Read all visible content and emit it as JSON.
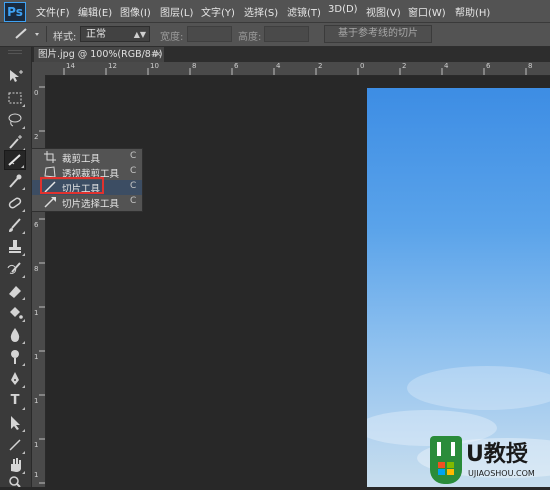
{
  "menubar": {
    "logo": "Ps",
    "items": [
      "文件(F)",
      "编辑(E)",
      "图像(I)",
      "图层(L)",
      "文字(Y)",
      "选择(S)",
      "滤镜(T)",
      "3D(D)",
      "视图(V)",
      "窗口(W)",
      "帮助(H)"
    ]
  },
  "options": {
    "style_label": "样式:",
    "style_value": "正常",
    "width_label": "宽度:",
    "height_label": "高度:",
    "slices_from_guides": "基于参考线的切片"
  },
  "document": {
    "tab_title": "图片.jpg @ 100%(RGB/8#)",
    "close": "×"
  },
  "rulers": {
    "top": [
      "14",
      "12",
      "10",
      "8",
      "6",
      "4",
      "2",
      "0",
      "2",
      "4",
      "6",
      "8"
    ],
    "left": [
      "0",
      "2",
      "4",
      "6",
      "8",
      "1",
      "1",
      "1",
      "1",
      "1"
    ]
  },
  "flyout": {
    "items": [
      {
        "icon": "crop-icon",
        "label": "裁剪工具",
        "key": "C"
      },
      {
        "icon": "perspective-crop-icon",
        "label": "透视裁剪工具",
        "key": "C"
      },
      {
        "icon": "slice-icon",
        "label": "切片工具",
        "key": "C",
        "selected": true
      },
      {
        "icon": "slice-select-icon",
        "label": "切片选择工具",
        "key": "C"
      }
    ]
  },
  "tools": [
    "move-tool",
    "marquee-tool",
    "lasso-tool",
    "magic-wand-tool",
    "crop-tool",
    "eyedropper-tool",
    "healing-brush-tool",
    "brush-tool",
    "clone-stamp-tool",
    "history-brush-tool",
    "eraser-tool",
    "gradient-tool",
    "blur-tool",
    "dodge-tool",
    "pen-tool",
    "type-tool",
    "path-selection-tool",
    "line-tool",
    "hand-tool",
    "zoom-tool"
  ],
  "watermark": {
    "title": "U教授",
    "url": "UJIAOSHOU.COM"
  },
  "colors": {
    "accent": "#e0322e",
    "ps_blue": "#3fa2f3",
    "panel": "#535353"
  }
}
